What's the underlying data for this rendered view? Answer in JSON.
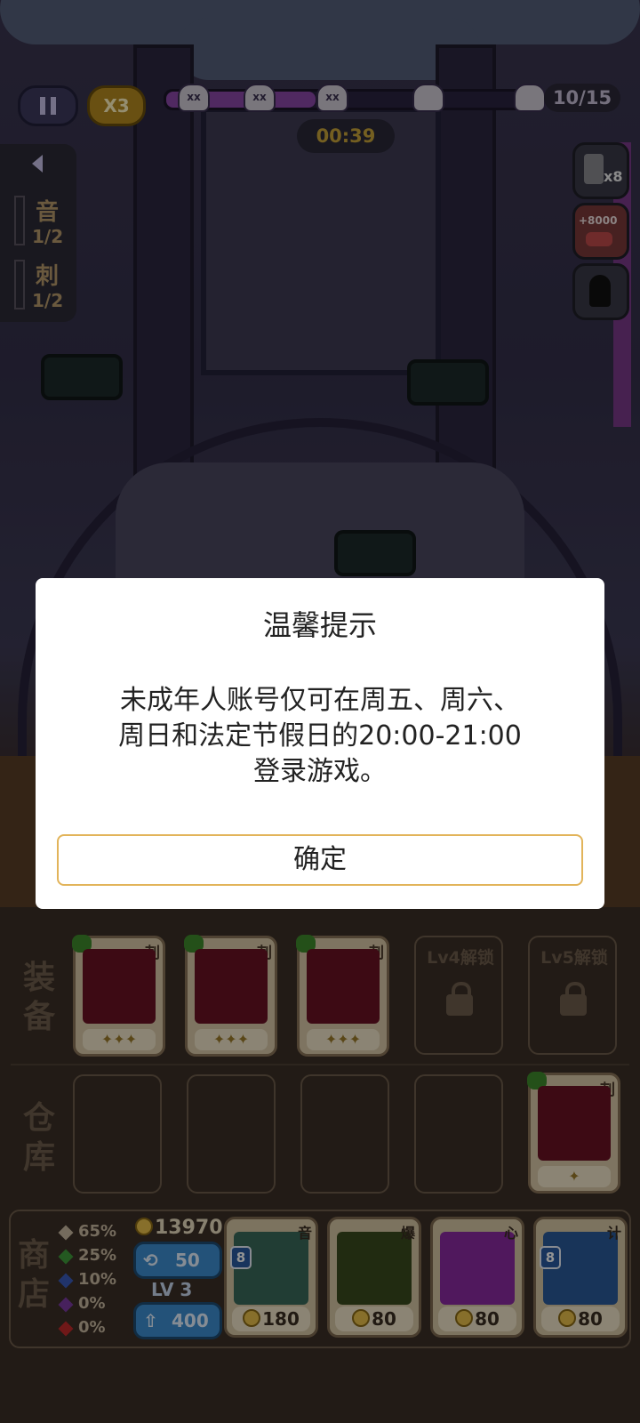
{
  "hud": {
    "speed_label": "X3",
    "wave_progress": 0.4,
    "wave_count": "10/15",
    "timer": "00:39"
  },
  "side_info": {
    "items": [
      {
        "label": "音",
        "value": "1/2"
      },
      {
        "label": "刺",
        "value": "1/2"
      }
    ]
  },
  "right_buttons": [
    "coin-stack-x8-icon",
    "plus-8000-icon",
    "cat-silhouette-icon"
  ],
  "right_button_texts": {
    "coin_multiplier": "x8",
    "bonus": "+8000"
  },
  "dialog": {
    "title": "温馨提示",
    "message_line1": "未成年人账号仅可在周五、周六、",
    "message_line2": "周日和法定节假日的20:00-21:00",
    "message_line3": "登录游戏。",
    "confirm_label": "确定"
  },
  "equip": {
    "label_top": "装",
    "label_bottom": "备",
    "cards": [
      {
        "tag": "刺",
        "stars": "✦✦✦"
      },
      {
        "tag": "刺",
        "stars": "✦✦✦"
      },
      {
        "tag": "刺",
        "stars": "✦✦✦"
      }
    ],
    "locked": [
      {
        "label": "Lv4解锁"
      },
      {
        "label": "Lv5解锁"
      }
    ]
  },
  "storage": {
    "label_top": "仓",
    "label_bottom": "库",
    "card": {
      "tag": "刺",
      "stars": "✦"
    }
  },
  "shop": {
    "label_top": "商",
    "label_bottom": "店",
    "odds": [
      {
        "value": "65%",
        "color": "#c9b8a0"
      },
      {
        "value": "25%",
        "color": "#3f9a3a"
      },
      {
        "value": "10%",
        "color": "#3a5ab8"
      },
      {
        "value": "0%",
        "color": "#7a3aa0"
      },
      {
        "value": "0%",
        "color": "#c02a2a"
      }
    ],
    "gold": "13970",
    "refresh_cost": "50",
    "level": "LV 3",
    "upgrade_cost": "400",
    "items": [
      {
        "tag": "音",
        "badge": "8",
        "price": "180",
        "art_color": "#3a6a5a"
      },
      {
        "tag": "爆",
        "badge": "",
        "price": "80",
        "art_color": "#3a4a1e"
      },
      {
        "tag": "心",
        "badge": "",
        "price": "80",
        "art_color": "#8a2aa0"
      },
      {
        "tag": "计",
        "badge": "8",
        "price": "80",
        "art_color": "#2a5a9a"
      }
    ]
  }
}
